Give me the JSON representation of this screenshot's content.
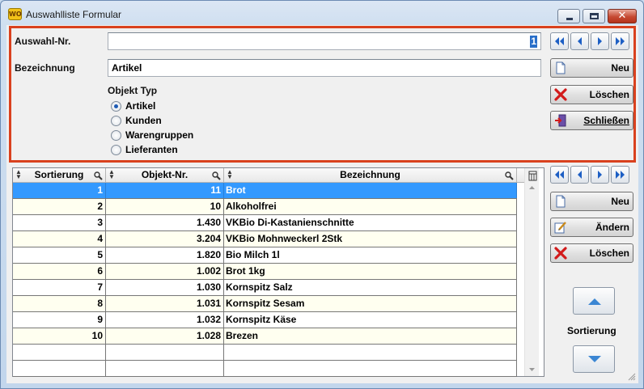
{
  "window": {
    "title": "Auswahlliste Formular",
    "app_icon_text": "WO",
    "close_glyph": "✕"
  },
  "form": {
    "auswahl_label": "Auswahl-Nr.",
    "auswahl_value": "1",
    "bezeichnung_label": "Bezeichnung",
    "bezeichnung_value": "Artikel",
    "objekt_typ_label": "Objekt Typ",
    "objekt_typen": [
      {
        "label": "Artikel",
        "checked": true
      },
      {
        "label": "Kunden",
        "checked": false
      },
      {
        "label": "Warengruppen",
        "checked": false
      },
      {
        "label": "Lieferanten",
        "checked": false
      }
    ]
  },
  "top_buttons": {
    "neu": "Neu",
    "loeschen": "Löschen",
    "schliessen": "Schließen"
  },
  "grid": {
    "columns": [
      "Sortierung",
      "Objekt-Nr.",
      "Bezeichnung"
    ],
    "rows": [
      {
        "sortierung": "1",
        "objekt_nr": "11",
        "bezeichnung": "Brot"
      },
      {
        "sortierung": "2",
        "objekt_nr": "10",
        "bezeichnung": "Alkoholfrei"
      },
      {
        "sortierung": "3",
        "objekt_nr": "1.430",
        "bezeichnung": "VKBio Di-Kastanienschnitte"
      },
      {
        "sortierung": "4",
        "objekt_nr": "3.204",
        "bezeichnung": "VKBio Mohnweckerl 2Stk"
      },
      {
        "sortierung": "5",
        "objekt_nr": "1.820",
        "bezeichnung": "Bio Milch 1l"
      },
      {
        "sortierung": "6",
        "objekt_nr": "1.002",
        "bezeichnung": "Brot 1kg"
      },
      {
        "sortierung": "7",
        "objekt_nr": "1.030",
        "bezeichnung": "Kornspitz Salz"
      },
      {
        "sortierung": "8",
        "objekt_nr": "1.031",
        "bezeichnung": "Kornspitz Sesam"
      },
      {
        "sortierung": "9",
        "objekt_nr": "1.032",
        "bezeichnung": "Kornspitz Käse"
      },
      {
        "sortierung": "10",
        "objekt_nr": "1.028",
        "bezeichnung": "Brezen"
      }
    ],
    "selected_row": 0
  },
  "side_buttons": {
    "neu": "Neu",
    "aendern": "Ändern",
    "loeschen": "Löschen",
    "sortierung_label": "Sortierung"
  },
  "icons": {
    "nav_first": "first-record-icon",
    "nav_prev": "previous-record-icon",
    "nav_next": "next-record-icon",
    "nav_last": "last-record-icon",
    "new": "new-document-icon",
    "edit": "edit-icon",
    "delete": "delete-x-icon",
    "close": "exit-door-icon",
    "move_up": "move-up-icon",
    "move_down": "move-down-icon"
  },
  "colors": {
    "highlight_border": "#d9411e",
    "selected_row": "#3399ff",
    "alt_row": "#fffff0",
    "nav_arrow": "#1d5fc4",
    "delete_red": "#d21a1a"
  }
}
